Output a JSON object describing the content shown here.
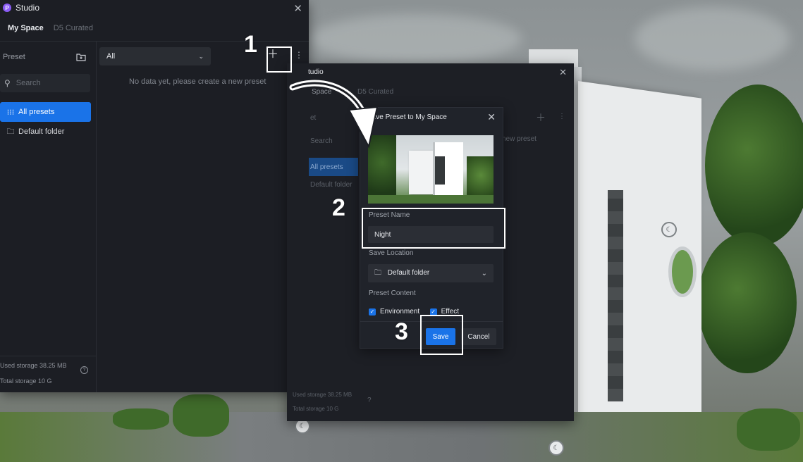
{
  "studio": {
    "title": "Studio",
    "logo_letter": "P",
    "tabs": [
      "My Space",
      "D5 Curated"
    ],
    "sidebar": {
      "section_title": "Preset",
      "search_placeholder": "Search",
      "items": [
        "All presets",
        "Default folder"
      ],
      "storage_used": "Used storage 38.25 MB",
      "storage_total": "Total storage 10 G"
    },
    "filter_value": "All",
    "empty_message": "No data yet, please create a new preset"
  },
  "studio_second": {
    "title": "tudio",
    "tab_fragment": "Space",
    "tab2": "D5 Curated",
    "preset_fragment": "et",
    "search": "Search",
    "items": [
      "All presets",
      "Default folder"
    ],
    "empty_fragment": "new preset",
    "storage_used": "Used storage 38.25 MB",
    "storage_total": "Total storage 10 G"
  },
  "dialog": {
    "title": "Save Preset to My Space",
    "name_label": "Preset Name",
    "name_value": "Night",
    "location_label": "Save Location",
    "location_value": "Default folder",
    "content_label": "Preset Content",
    "checkbox_environment": "Environment",
    "checkbox_effect": "Effect",
    "save_label": "Save",
    "cancel_label": "Cancel"
  },
  "annotations": [
    "1",
    "2",
    "3"
  ],
  "colors": {
    "accent": "#1a73e8",
    "panel": "#1c1e24",
    "logo": "#8b5cf6"
  }
}
